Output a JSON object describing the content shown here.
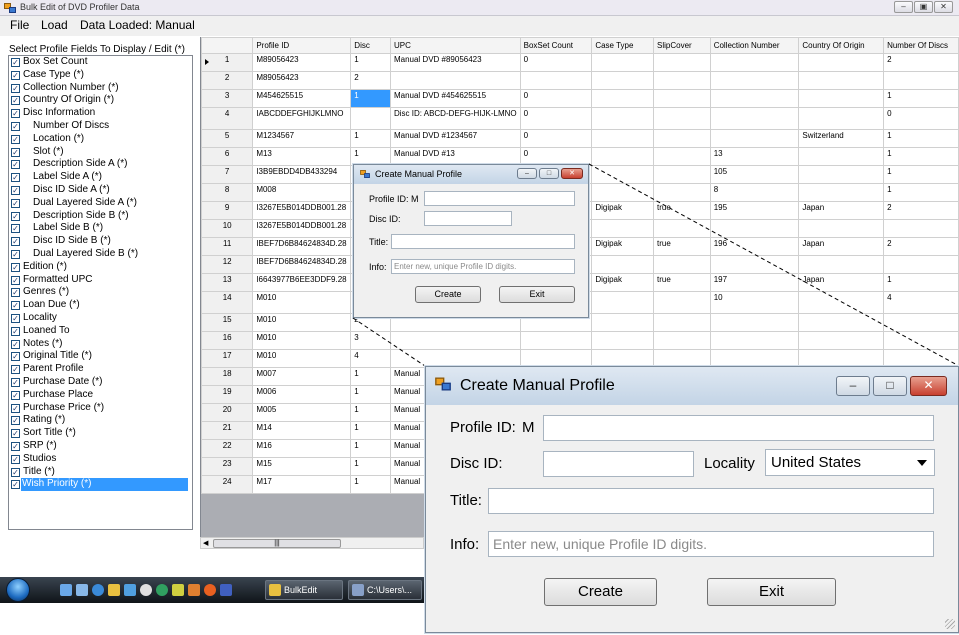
{
  "window": {
    "title": "Bulk Edit of DVD Profiler Data"
  },
  "menu": [
    {
      "label": "File"
    },
    {
      "label": "Load"
    },
    {
      "label": "Data Loaded: Manual"
    }
  ],
  "fields": {
    "label": "Select Profile Fields To Display / Edit (*)",
    "items": [
      {
        "label": "Box Set Count",
        "level": 0
      },
      {
        "label": "Case Type (*)",
        "level": 0
      },
      {
        "label": "Collection Number (*)",
        "level": 0
      },
      {
        "label": "Country Of Origin (*)",
        "level": 0
      },
      {
        "label": "Disc Information",
        "level": 0
      },
      {
        "label": "Number Of Discs",
        "level": 1
      },
      {
        "label": "Location (*)",
        "level": 1
      },
      {
        "label": "Slot (*)",
        "level": 1
      },
      {
        "label": "Description Side A (*)",
        "level": 1
      },
      {
        "label": "Label Side A (*)",
        "level": 1
      },
      {
        "label": "Disc ID Side A (*)",
        "level": 1
      },
      {
        "label": "Dual Layered Side A (*)",
        "level": 1
      },
      {
        "label": "Description Side B (*)",
        "level": 1
      },
      {
        "label": "Label Side B (*)",
        "level": 1
      },
      {
        "label": "Disc ID Side B (*)",
        "level": 1
      },
      {
        "label": "Dual Layered Side B (*)",
        "level": 1
      },
      {
        "label": "Edition (*)",
        "level": 0
      },
      {
        "label": "Formatted UPC",
        "level": 0
      },
      {
        "label": "Genres (*)",
        "level": 0
      },
      {
        "label": "Loan Due (*)",
        "level": 0
      },
      {
        "label": "Locality",
        "level": 0
      },
      {
        "label": "Loaned To",
        "level": 0
      },
      {
        "label": "Notes (*)",
        "level": 0
      },
      {
        "label": "Original Title (*)",
        "level": 0
      },
      {
        "label": "Parent Profile",
        "level": 0
      },
      {
        "label": "Purchase Date (*)",
        "level": 0
      },
      {
        "label": "Purchase Place",
        "level": 0
      },
      {
        "label": "Purchase Price (*)",
        "level": 0
      },
      {
        "label": "Rating (*)",
        "level": 0
      },
      {
        "label": "Sort Title (*)",
        "level": 0
      },
      {
        "label": "SRP (*)",
        "level": 0
      },
      {
        "label": "Studios",
        "level": 0
      },
      {
        "label": "Title (*)",
        "level": 0
      },
      {
        "label": "Wish Priority (*)",
        "level": 0,
        "selected": true
      }
    ]
  },
  "grid": {
    "columns": [
      "",
      "Profile ID",
      "Disc",
      "UPC",
      "BoxSet Count",
      "Case Type",
      "SlipCover",
      "Collection Number",
      "Country Of Origin",
      "Number Of Discs"
    ],
    "rows": [
      [
        "1",
        "M89056423",
        "1",
        "Manual DVD #89056423",
        "0",
        "",
        "",
        "",
        "",
        "2"
      ],
      [
        "2",
        "M89056423",
        "2",
        "",
        "",
        "",
        "",
        "",
        "",
        ""
      ],
      [
        "3",
        "M454625515",
        "1",
        "Manual DVD #454625515",
        "0",
        "",
        "",
        "",
        "",
        "1"
      ],
      [
        "4",
        "IABCDDEFGHIJKLMNO",
        "",
        "Disc ID: ABCD-DEFG-HIJK-LMNO",
        "0",
        "",
        "",
        "",
        "",
        "0"
      ],
      [
        "5",
        "M1234567",
        "1",
        "Manual DVD #1234567",
        "0",
        "",
        "",
        "",
        "Switzerland",
        "1"
      ],
      [
        "6",
        "M13",
        "1",
        "Manual DVD #13",
        "0",
        "",
        "",
        "13",
        "",
        "1"
      ],
      [
        "7",
        "I3B9EBDD4DB433294",
        "",
        "",
        "",
        "",
        "",
        "105",
        "",
        "1"
      ],
      [
        "8",
        "M008",
        "",
        "",
        "",
        "",
        "",
        "8",
        "",
        "1"
      ],
      [
        "9",
        "I3267E5B014DDB001.28",
        "",
        "",
        "",
        "Digipak",
        "true",
        "195",
        "Japan",
        "2"
      ],
      [
        "10",
        "I3267E5B014DDB001.28",
        "",
        "",
        "",
        "",
        "",
        "",
        "",
        ""
      ],
      [
        "11",
        "IBEF7D6B84624834D.28",
        "",
        "",
        "",
        "Digipak",
        "true",
        "196",
        "Japan",
        "2"
      ],
      [
        "12",
        "IBEF7D6B84624834D.28",
        "",
        "",
        "",
        "",
        "",
        "",
        "",
        ""
      ],
      [
        "13",
        "I6643977B6EE3DDF9.28",
        "",
        "",
        "",
        "Digipak",
        "true",
        "197",
        "Japan",
        "1"
      ],
      [
        "14",
        "M010",
        "",
        "",
        "",
        "",
        "",
        "10",
        "",
        "4"
      ],
      [
        "15",
        "M010",
        "2",
        "",
        "",
        "",
        "",
        "",
        "",
        ""
      ],
      [
        "16",
        "M010",
        "3",
        "",
        "",
        "",
        "",
        "",
        "",
        ""
      ],
      [
        "17",
        "M010",
        "4",
        "",
        "",
        "",
        "",
        "",
        "",
        ""
      ],
      [
        "18",
        "M007",
        "1",
        "Manual",
        "",
        "",
        "",
        "",
        "",
        ""
      ],
      [
        "19",
        "M006",
        "1",
        "Manual",
        "",
        "",
        "",
        "",
        "",
        ""
      ],
      [
        "20",
        "M005",
        "1",
        "Manual",
        "",
        "",
        "",
        "",
        "",
        ""
      ],
      [
        "21",
        "M14",
        "1",
        "Manual",
        "",
        "",
        "",
        "",
        "",
        ""
      ],
      [
        "22",
        "M16",
        "1",
        "Manual",
        "",
        "",
        "",
        "",
        "",
        ""
      ],
      [
        "23",
        "M15",
        "1",
        "Manual",
        "",
        "",
        "",
        "",
        "",
        ""
      ],
      [
        "24",
        "M17",
        "1",
        "Manual",
        "",
        "",
        "",
        "",
        "",
        ""
      ]
    ],
    "current_row": 1,
    "selected_cell": {
      "row": 3,
      "col": 2
    }
  },
  "dialog": {
    "title": "Create Manual Profile",
    "profile_id_label": "Profile ID:",
    "profile_id_prefix": "M",
    "disc_id_label": "Disc ID:",
    "locality_label": "Locality",
    "locality_value": "United States",
    "title_label": "Title:",
    "info_label": "Info:",
    "info_placeholder": "Enter new, unique Profile ID digits.",
    "create_label": "Create",
    "exit_label": "Exit"
  },
  "taskbar": {
    "buttons": [
      {
        "label": "BulkEdit"
      },
      {
        "label": "C:\\Users\\..."
      }
    ]
  },
  "colors": {
    "selection": "#3399ff",
    "window_bg": "#f0f0f0"
  }
}
